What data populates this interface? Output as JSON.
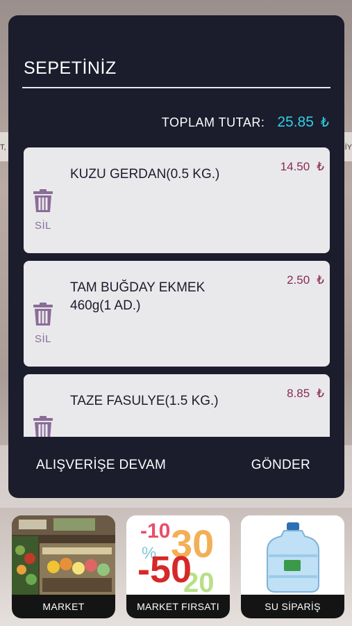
{
  "cart": {
    "title": "SEPETİNİZ",
    "total_label": "TOPLAM TUTAR:",
    "total_value": "25.85",
    "currency": "₺",
    "delete_label": "SİL",
    "items": [
      {
        "name": "KUZU GERDAN(0.5 KG.)",
        "price": "14.50"
      },
      {
        "name": "TAM BUĞDAY EKMEK 460g(1 AD.)",
        "price": "2.50"
      },
      {
        "name": "TAZE FASULYE(1.5 KG.)",
        "price": "8.85"
      }
    ],
    "continue_label": "ALIŞVERİŞE DEVAM",
    "send_label": "GÖNDER"
  },
  "background": {
    "strip_left_text": "T,",
    "strip_right_text": "İY"
  },
  "categories": [
    {
      "label": "MARKET",
      "icon": "market-shelf-image"
    },
    {
      "label": "MARKET FIRSATI",
      "icon": "discount-percent-image",
      "promo_texts": [
        "-10",
        "30",
        "-50",
        "20"
      ]
    },
    {
      "label": "SU SİPARİŞ",
      "icon": "water-bottle-image"
    }
  ],
  "colors": {
    "modal_bg": "#1b1c2c",
    "accent_total": "#2fd0e6",
    "price": "#8a2a4e",
    "delete": "#8a6c97",
    "item_bg": "#e9e9ec"
  }
}
